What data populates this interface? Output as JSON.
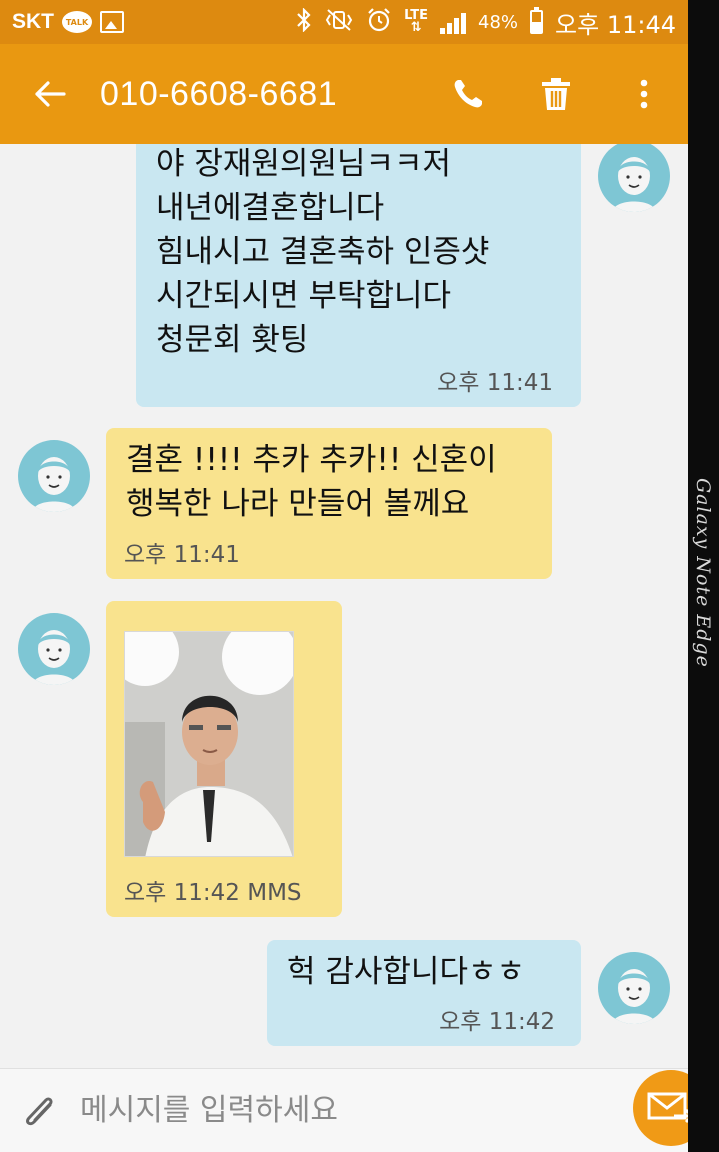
{
  "status_bar": {
    "carrier": "SKT",
    "talk_badge": "TALK",
    "battery_percent": "48%",
    "battery_level": 0.48,
    "time": "오후 11:44"
  },
  "app_bar": {
    "contact": "010-6608-6681",
    "back_icon": "back-arrow-icon",
    "call_icon": "phone-icon",
    "delete_icon": "trash-icon",
    "menu_icon": "more-vert-icon"
  },
  "messages": [
    {
      "direction": "outgoing",
      "text": "야 장재원의원님ㅋㅋ저\n내년에결혼합니다\n힘내시고 결혼축하 인증샷\n시간되시면 부탁합니다\n청문회 홧팅",
      "time": "오후 11:41"
    },
    {
      "direction": "incoming",
      "text": "결혼 !!!! 추카 추카!! 신혼이\n행복한 나라 만들어 볼께요",
      "time": "오후 11:41"
    },
    {
      "direction": "incoming",
      "type": "image",
      "time": "오후 11:42 MMS"
    },
    {
      "direction": "outgoing",
      "text": "헉 감사합니다ㅎㅎ",
      "time": "오후 11:42"
    }
  ],
  "input": {
    "placeholder": "메시지를 입력하세요",
    "attach_icon": "paperclip-icon",
    "send_icon": "send-envelope-icon"
  },
  "device_edge_label": "Galaxy Note Edge",
  "colors": {
    "status_bar": "#dd8a10",
    "app_bar": "#e99811",
    "outgoing_bubble": "#c9e7f1",
    "incoming_bubble": "#f9e38e",
    "send_button": "#f09a16",
    "avatar": "#7ec6d4"
  }
}
